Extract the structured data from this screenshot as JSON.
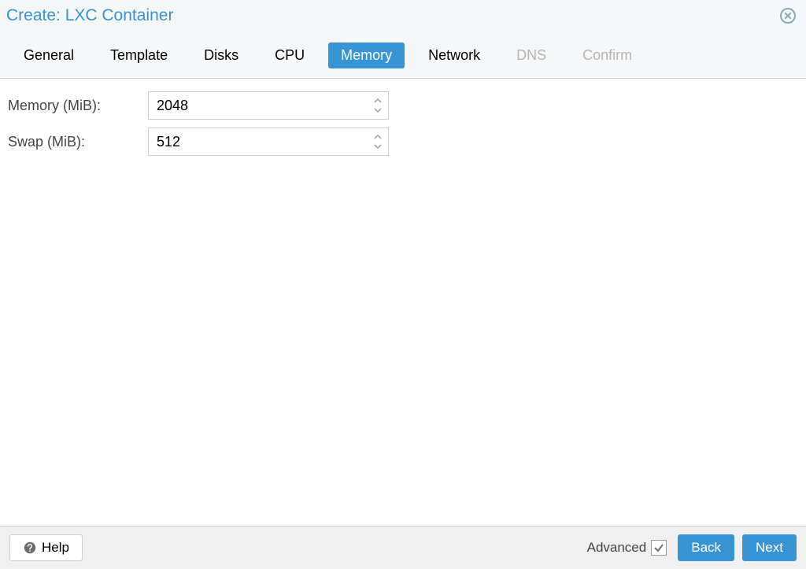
{
  "dialog": {
    "title": "Create: LXC Container"
  },
  "tabs": [
    {
      "id": "general",
      "label": "General",
      "state": "normal"
    },
    {
      "id": "template",
      "label": "Template",
      "state": "normal"
    },
    {
      "id": "disks",
      "label": "Disks",
      "state": "normal"
    },
    {
      "id": "cpu",
      "label": "CPU",
      "state": "normal"
    },
    {
      "id": "memory",
      "label": "Memory",
      "state": "active"
    },
    {
      "id": "network",
      "label": "Network",
      "state": "normal"
    },
    {
      "id": "dns",
      "label": "DNS",
      "state": "disabled"
    },
    {
      "id": "confirm",
      "label": "Confirm",
      "state": "disabled"
    }
  ],
  "fields": {
    "memory": {
      "label": "Memory (MiB):",
      "value": "2048"
    },
    "swap": {
      "label": "Swap (MiB):",
      "value": "512"
    }
  },
  "footer": {
    "help": "Help",
    "advanced": "Advanced",
    "advanced_checked": true,
    "back": "Back",
    "next": "Next"
  },
  "colors": {
    "accent": "#3892d4",
    "button_primary": "#3794d5"
  }
}
